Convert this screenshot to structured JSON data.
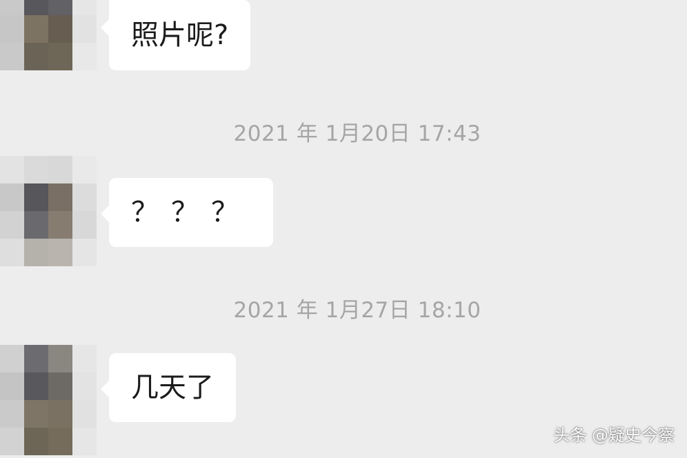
{
  "messages": [
    {
      "text": "照片呢?"
    },
    {
      "text": "？？？"
    },
    {
      "text": "几天了"
    }
  ],
  "timestamps": [
    "2021 年 1月20日 17:43",
    "2021 年 1月27日 18:10"
  ],
  "watermark": "头条 @疑史今察",
  "colors": {
    "background": "#ededed",
    "bubble": "#ffffff",
    "timestamp_text": "#a5a5a5",
    "message_text": "#1b1b1b"
  },
  "avatars": [
    {
      "icon": "pixelated-avatar",
      "pixels": [
        "#d5d5d5",
        "#6f6f73",
        "#9c9994",
        "#e6e6e6",
        "#c9c9c9",
        "#58575c",
        "#626166",
        "#e6e6e6",
        "#c6c6c6",
        "#7d7363",
        "#675d50",
        "#e2e2e2",
        "#c9c9c9",
        "#6b6456",
        "#6e6656",
        "#e8e8e8"
      ]
    },
    {
      "icon": "pixelated-avatar",
      "pixels": [
        "#e3e3e3",
        "#dadada",
        "#d8d8d8",
        "#e9e9e9",
        "#c8c8c8",
        "#56565b",
        "#7a6f64",
        "#dcdcdc",
        "#d2d2d2",
        "#6a6a6e",
        "#877c70",
        "#d8d8d8",
        "#dedede",
        "#b5b1ab",
        "#b9b4ad",
        "#e5e5e5"
      ]
    },
    {
      "icon": "pixelated-avatar",
      "pixels": [
        "#d0d0d0",
        "#6c6c70",
        "#8a8680",
        "#e6e6e6",
        "#c4c4c4",
        "#58585d",
        "#6d6a66",
        "#e3e3e3",
        "#cacaca",
        "#7f7566",
        "#7a7162",
        "#e1e1e1",
        "#d2d2d2",
        "#6d6556",
        "#756c5c",
        "#e6e6e6"
      ]
    }
  ]
}
